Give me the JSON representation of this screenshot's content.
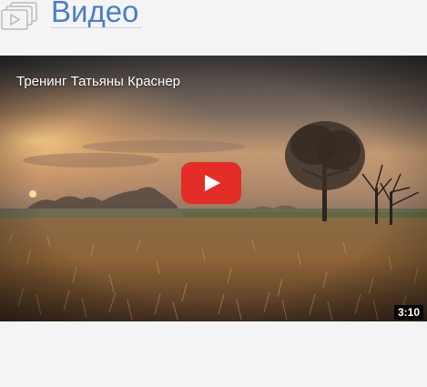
{
  "header": {
    "title": "Видео",
    "icon": "video-gallery-icon",
    "title_color": "#4a7ec5"
  },
  "video": {
    "title": "Тренинг Татьяны Краснер",
    "duration": "3:10",
    "play_icon": "play-icon",
    "play_color": "#e52d27"
  }
}
